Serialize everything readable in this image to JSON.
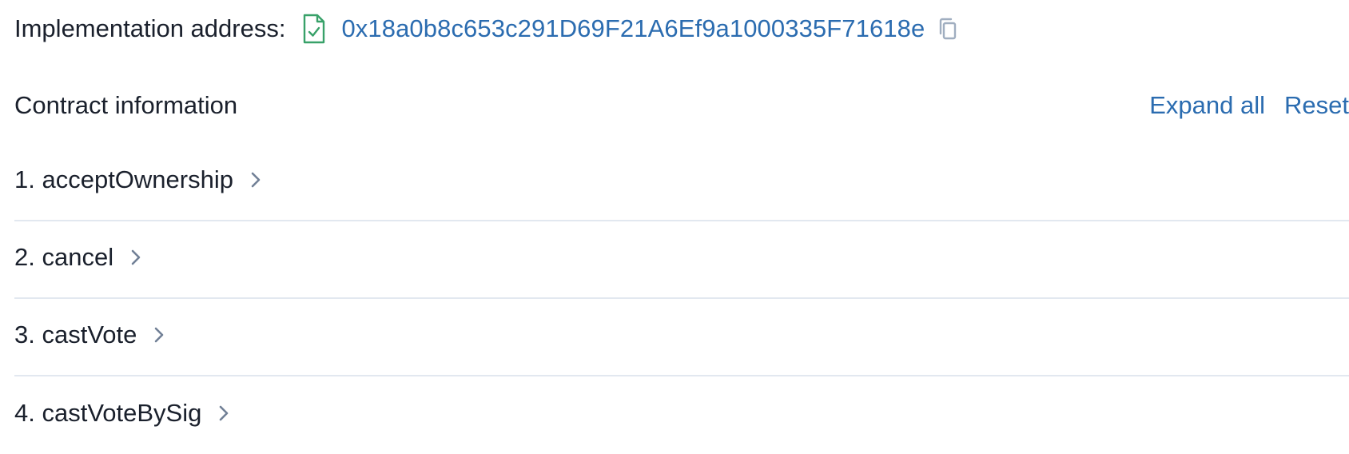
{
  "implementation": {
    "label": "Implementation address:",
    "address": "0x18a0b8c653c291D69F21A6Ef9a1000335F71618e",
    "icons": {
      "contract": "verified-contract-icon",
      "copy": "copy-icon"
    }
  },
  "contract_info": {
    "title": "Contract information",
    "expand_all_label": "Expand all",
    "reset_label": "Reset"
  },
  "methods": [
    {
      "label": "1. acceptOwnership"
    },
    {
      "label": "2. cancel"
    },
    {
      "label": "3. castVote"
    },
    {
      "label": "4. castVoteBySig"
    }
  ],
  "colors": {
    "link": "#2b6cb0",
    "text": "#1a202c",
    "verified_green": "#38a169",
    "icon_gray": "#a0aec0",
    "divider": "#e2e8f0"
  }
}
